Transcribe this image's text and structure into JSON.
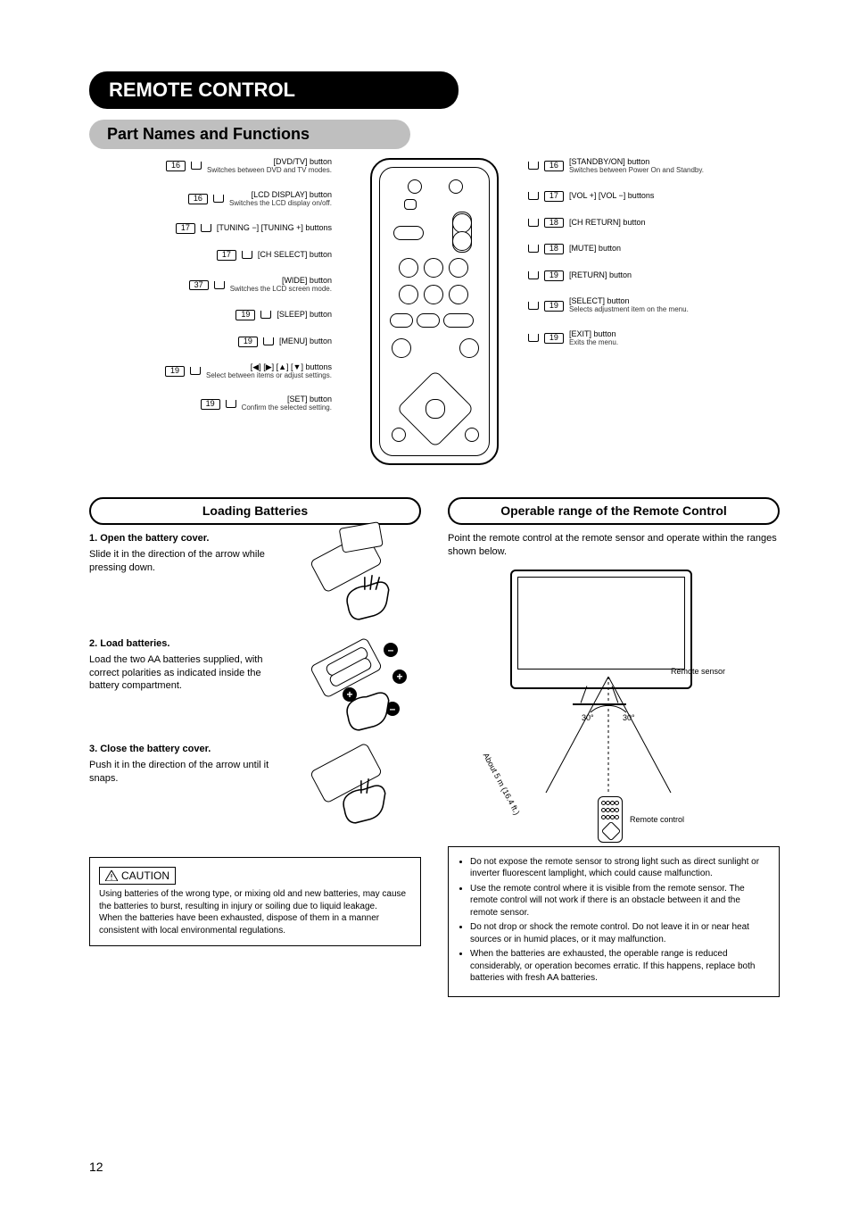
{
  "headers": {
    "title": "REMOTE CONTROL",
    "subtitle": "Part Names and Functions"
  },
  "callouts_left": [
    {
      "label": "[DVD/TV] button",
      "sub": "Switches between DVD and TV modes.",
      "pg": "16"
    },
    {
      "label": "[LCD DISPLAY] button",
      "sub": "Switches the LCD display on/off.",
      "pg": "16"
    },
    {
      "label": "[TUNING −] [TUNING +] buttons",
      "sub": "",
      "pg": "17"
    },
    {
      "label": "[CH SELECT] button",
      "sub": "",
      "pg": "17"
    },
    {
      "label": "[WIDE] button",
      "sub": "Switches the LCD screen mode.",
      "pg": "37"
    },
    {
      "label": "[SLEEP] button",
      "sub": "",
      "pg": "19"
    },
    {
      "label": "[MENU] button",
      "sub": "",
      "pg": "19"
    },
    {
      "label": "[◀] [▶] [▲] [▼] buttons",
      "sub": "Select between items or adjust settings.",
      "pg": "19"
    },
    {
      "label": "[SET] button",
      "sub": "Confirm the selected setting.",
      "pg": "19"
    }
  ],
  "callouts_right": [
    {
      "label": "[STANDBY/ON] button",
      "sub": "Switches between Power On and Standby.",
      "pg": "16"
    },
    {
      "label": "[VOL +] [VOL −] buttons",
      "sub": "",
      "pg": "17"
    },
    {
      "label": "[CH RETURN] button",
      "sub": "",
      "pg": "18"
    },
    {
      "label": "[MUTE] button",
      "sub": "",
      "pg": "18"
    },
    {
      "label": "[RETURN] button",
      "sub": "",
      "pg": "19"
    },
    {
      "label": "[SELECT] button",
      "sub": "Selects adjustment item on the menu.",
      "pg": "19"
    },
    {
      "label": "[EXIT] button",
      "sub": "Exits the menu.",
      "pg": "19"
    }
  ],
  "left_col": {
    "heading": "Loading Batteries",
    "step1": {
      "title": "1. Open the battery cover.",
      "body": "Slide it in the direction of the arrow while pressing down."
    },
    "step2": {
      "title": "2. Load batteries.",
      "body": "Load the two AA batteries supplied, with correct polarities as indicated inside the battery compartment."
    },
    "step3": {
      "title": "3. Close the battery cover.",
      "body": "Push it in the direction of the arrow until it snaps."
    },
    "caution_label": "CAUTION",
    "caution_body": "Using batteries of the wrong type, or mixing old and new batteries, may cause the batteries to burst, resulting in injury or soiling due to liquid leakage.\nWhen the batteries have been exhausted, dispose of them in a manner consistent with local environmental regulations."
  },
  "right_col": {
    "heading": "Operable range of the Remote Control",
    "intro": "Point the remote control at the remote sensor and operate within the ranges shown below.",
    "fig": {
      "sensor_label": "Remote sensor",
      "distance_label": "About 5 m (16.4 ft.)",
      "angle_l": "30°",
      "angle_r": "30°",
      "remote_label": "Remote control"
    },
    "info_bullets": [
      "Do not expose the remote sensor to strong light such as direct sunlight or inverter fluorescent lamplight, which could cause malfunction.",
      "Use the remote control where it is visible from the remote sensor. The remote control will not work if there is an obstacle between it and the remote sensor.",
      "Do not drop or shock the remote control. Do not leave it in or near heat sources or in humid places, or it may malfunction.",
      "When the batteries are exhausted, the operable range is reduced considerably, or operation becomes erratic. If this happens, replace both batteries with fresh AA batteries."
    ]
  },
  "page_number": "12"
}
